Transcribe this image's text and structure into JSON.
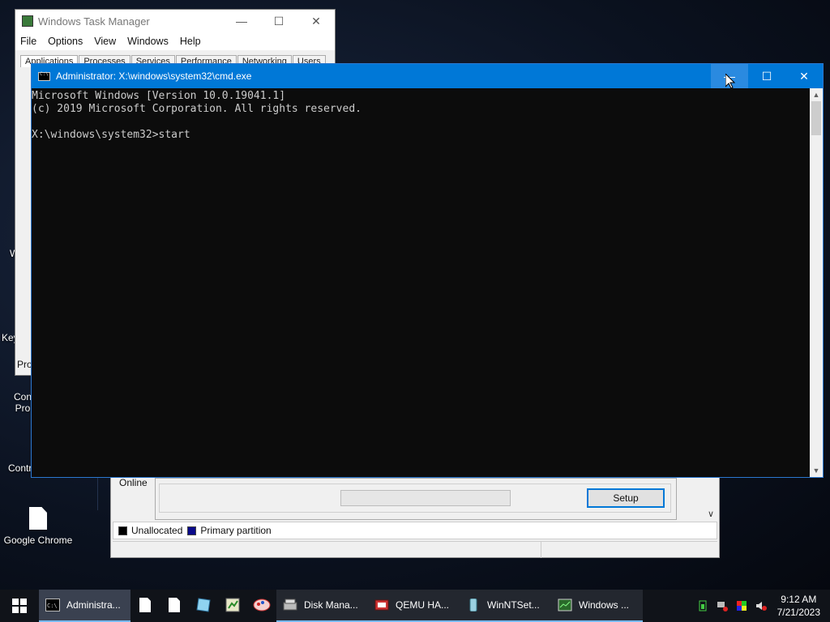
{
  "desktop": {
    "icons": [
      {
        "label": "Google Chrome"
      }
    ],
    "partial_labels": [
      "W",
      "Key",
      "Con\nPro",
      "Contr"
    ]
  },
  "task_manager": {
    "title": "Windows Task Manager",
    "menu": [
      "File",
      "Options",
      "View",
      "Windows",
      "Help"
    ],
    "tabs": [
      "Applications",
      "Processes",
      "Services",
      "Performance",
      "Networking",
      "Users"
    ],
    "bottom_label": "Pro"
  },
  "disk_management": {
    "online_label": "Online",
    "setup_label": "Setup",
    "legend": [
      {
        "label": "Unallocated",
        "color": "#000000"
      },
      {
        "label": "Primary partition",
        "color": "#0a0a8a"
      }
    ]
  },
  "cmd": {
    "title": "Administrator: X:\\windows\\system32\\cmd.exe",
    "controls": {
      "minimize": "—",
      "maximize": "☐",
      "close": "✕"
    },
    "lines": [
      "Microsoft Windows [Version 10.0.19041.1]",
      "(c) 2019 Microsoft Corporation. All rights reserved.",
      "",
      "X:\\windows\\system32>start"
    ]
  },
  "taskbar": {
    "buttons": [
      {
        "label": "Administra...",
        "icon": "cmd-icon"
      },
      {
        "label": "",
        "icon": "file-icon"
      },
      {
        "label": "",
        "icon": "file-icon"
      },
      {
        "label": "",
        "icon": "notepad-icon"
      },
      {
        "label": "",
        "icon": "regedit-icon"
      },
      {
        "label": "",
        "icon": "paint-icon"
      },
      {
        "label": "Disk Mana...",
        "icon": "disk-management-icon"
      },
      {
        "label": "QEMU HA...",
        "icon": "qemu-icon"
      },
      {
        "label": "WinNTSet...",
        "icon": "setup-icon"
      },
      {
        "label": "Windows ...",
        "icon": "task-manager-icon"
      }
    ],
    "clock": {
      "time": "9:12 AM",
      "date": "7/21/2023"
    }
  }
}
